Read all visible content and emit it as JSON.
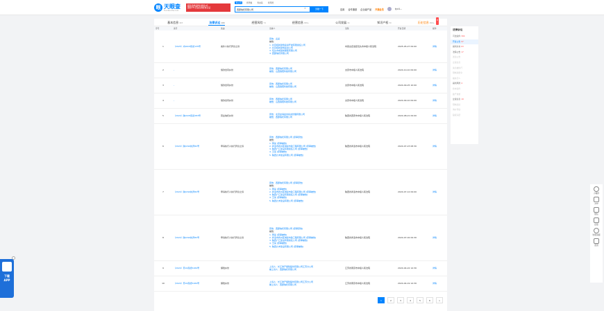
{
  "header": {
    "logo_text": "天眼查",
    "logo_sub": "TianYanCha.com",
    "banner_lines": [
      "服务品牌品牌信誉第1名",
      "国际CTL企业信用标准认证"
    ],
    "search_tabs": [
      "查公司",
      "查老板",
      "查关系",
      "查风险"
    ],
    "search_value": "西部信托有限公司",
    "search_button": "天眼一下",
    "nav": [
      "应用",
      "合作通道",
      "企业级产品",
      "开通会员",
      "tyc4..."
    ]
  },
  "tabs": [
    {
      "label": "基本信息",
      "count": "493"
    },
    {
      "label": "法律诉讼",
      "count": "196"
    },
    {
      "label": "经营风险",
      "count": "74"
    },
    {
      "label": "经营信息",
      "count": "999+"
    },
    {
      "label": "公司发展",
      "count": "16"
    },
    {
      "label": "知识产权",
      "count": "50"
    },
    {
      "label": "历史信息",
      "count": "999+",
      "badge": "新"
    }
  ],
  "table": {
    "headers": [
      "序号",
      "案号",
      "案由",
      "当事人",
      "法院",
      "开庭日期",
      "操作"
    ],
    "rows": [
      {
        "no": "1",
        "case": "（2025）内0203民初135号",
        "cause": "案外人执行异议之诉",
        "parties": [
          "原告：袁某",
          "被告：",
          "1. 北京拓新建筑投资开发有限责任公司",
          "2. 北京拓新建筑投资公司",
          "3. 包头市成建新服装有限公司",
          "4. 西部信托有限公司"
        ],
        "court": "内蒙古自治区包头市中级人民法院",
        "date": "2025-05-27 09:00",
        "action": "详情"
      },
      {
        "no": "2",
        "case": "-",
        "cause": "借款合同纠纷",
        "parties": [
          "原告：西部信托有限公司",
          "被告：山西锦阳科技有限公司"
        ],
        "court": "太原市中级人民法院",
        "date": "2024-10-10 09:00",
        "action": "详情"
      },
      {
        "no": "3",
        "case": "-",
        "cause": "借款合同纠纷",
        "parties": [
          "原告：西部信托有限公司",
          "被告：山西锦阳科技有限公司"
        ],
        "court": "太原市中级人民法院",
        "date": "2024-09-25 10:00",
        "action": "详情"
      },
      {
        "no": "4",
        "case": "-",
        "cause": "借款合同纠纷",
        "parties": [
          "原告：西部信托有限公司",
          "被告：山西锦阳科技有限公司"
        ],
        "court": "太原市中级人民法院",
        "date": "2024-09-10 09:00",
        "action": "详情"
      },
      {
        "no": "5",
        "case": "（2024）陕0105民初283号",
        "cause": "营业信托纠纷",
        "parties": [
          "原告：北京益海嘉禾投资管理有限公司",
          "被告：西部信托有限公司"
        ],
        "court": "陕西省西安市中级人民法院",
        "date": "2024-08-21 09:00",
        "action": "详情"
      },
      {
        "no": "6",
        "case": "（2024）陕1092执异82号",
        "cause": "申请执行人执行异议之诉",
        "parties": [
          "原告：西部信托有限公司 [原审原告]",
          "被告：",
          "1. 黄某 [原审被告]",
          "2. 商洛市商州区城投市政工程有限公司 [原审被告]",
          "3. 陕西广汇建设有限责任公司 [原审被告]",
          "4. 王某 [原审被告]",
          "5. 陕西九丰建设有限公司 [原审被告]"
        ],
        "court": "陕西省商洛市中级人民法院",
        "date": "2024-07-23 08:30",
        "action": "详情"
      },
      {
        "no": "7",
        "case": "（2024）陕1092执异82号",
        "cause": "申请执行人执行异议之诉",
        "parties": [
          "原告：西部信托有限公司 [原审原告]",
          "被告：",
          "1. 黄某 [原审被告]",
          "2. 商洛市商州区城投市政工程有限公司 [原审被告]",
          "3. 陕西广汇建设有限责任公司 [原审被告]",
          "4. 王某 [原审被告]",
          "5. 陕西九丰建设有限公司 [原审被告]"
        ],
        "court": "陕西省商洛市中级人民法院",
        "date": "2024-07-12 09:00",
        "action": "详情"
      },
      {
        "no": "8",
        "case": "（2024）陕1092执异82号",
        "cause": "申请执行人执行异议之诉",
        "parties": [
          "原告：西部信托有限公司 [原审原告]",
          "被告：",
          "1. 黄某 [原审被告]",
          "2. 商洛市商州区城投市政工程有限公司 [原审被告]",
          "3. 陕西广汇建设有限责任公司 [原审被告]",
          "4. 王某 [原审被告]",
          "5. 陕西九丰建设有限公司 [原审被告]"
        ],
        "court": "陕西省商洛市中级人民法院",
        "date": "2024-07-02 09:30",
        "action": "详情"
      },
      {
        "no": "9",
        "case": "（2024）苏01民终5184号",
        "cause": "保险纠纷",
        "parties": [
          "上诉人：长江财产保险股份有限公司江苏分公司",
          "被上诉人：西部信托有限公司"
        ],
        "court": "江苏省南京市中级人民法院",
        "date": "2024-04-22 14:30",
        "action": "详情"
      },
      {
        "no": "10",
        "case": "（2024）苏01民终5184号",
        "cause": "保险纠纷",
        "parties": [
          "上诉人：长江财产保险股份有限公司江苏分公司",
          "被上诉人：西部信托有限公司"
        ],
        "court": "江苏省南京市中级人民法院",
        "date": "2024-04-19 14:30",
        "action": "详情"
      }
    ]
  },
  "pager": [
    "1",
    "2",
    "3",
    "4",
    "5",
    "6",
    ">"
  ],
  "sidenav": {
    "title": "法律诉讼",
    "items": [
      {
        "label": "司法案件",
        "count": "304",
        "state": "normal"
      },
      {
        "label": "开庭公告",
        "count": "97",
        "state": "active"
      },
      {
        "label": "裁判文书",
        "count": "63",
        "state": "normal"
      },
      {
        "label": "法院公告",
        "count": "17",
        "state": "normal"
      },
      {
        "label": "送达公告",
        "count": "",
        "state": "disabled"
      },
      {
        "label": "立案信息",
        "count": "",
        "state": "disabled"
      },
      {
        "label": "失信被执行",
        "count": "",
        "state": "disabled"
      },
      {
        "label": "限制消费令",
        "count": "",
        "state": "disabled"
      },
      {
        "label": "被执行人",
        "count": "",
        "state": "disabled"
      },
      {
        "label": "裁判风险",
        "count": "4",
        "state": "normal"
      },
      {
        "label": "终本案件",
        "count": "",
        "state": "disabled"
      },
      {
        "label": "破产重整",
        "count": "",
        "state": "disabled"
      },
      {
        "label": "立案信息",
        "count": "19",
        "state": "normal"
      },
      {
        "label": "限制出境",
        "count": "",
        "state": "disabled"
      },
      {
        "label": "询价评估",
        "count": "",
        "state": "disabled"
      },
      {
        "label": "股权冻结",
        "count": "",
        "state": "disabled"
      }
    ]
  },
  "rightbar": [
    "小程序",
    "APP",
    "微信",
    "反馈",
    "智能客服",
    "置顶"
  ],
  "app_float": {
    "label1": "下载",
    "label2": "APP"
  }
}
